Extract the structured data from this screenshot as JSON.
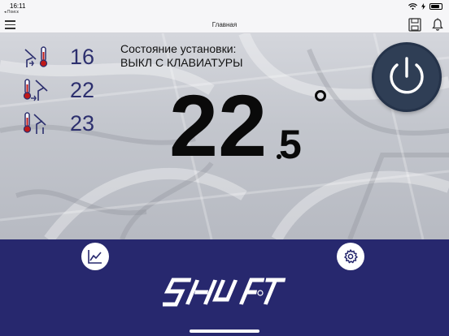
{
  "status_bar": {
    "time": "16:11",
    "back_label": "◂ Поиск",
    "battery_level": 0.85
  },
  "nav": {
    "title": "Главная",
    "menu_icon": "hamburger-icon",
    "save_icon": "save-icon",
    "notify_icon": "bell-icon"
  },
  "readings": [
    {
      "icon": "outdoor-temperature-icon",
      "value": "16"
    },
    {
      "icon": "supply-temperature-icon",
      "value": "22"
    },
    {
      "icon": "room-temperature-icon",
      "value": "23"
    }
  ],
  "state": {
    "label": "Состояние установки:",
    "value": "ВЫКЛ С КЛАВИАТУРЫ"
  },
  "temperature": {
    "integer": "22",
    "fraction": "5"
  },
  "controls": {
    "power_icon": "power-icon",
    "chart_icon": "chart-icon",
    "settings_icon": "gear-icon"
  },
  "brand": {
    "logo": "shuft-logo",
    "panel_color": "#27286e",
    "value_color": "#2c2f6e",
    "power_color": "#2f3e55"
  }
}
